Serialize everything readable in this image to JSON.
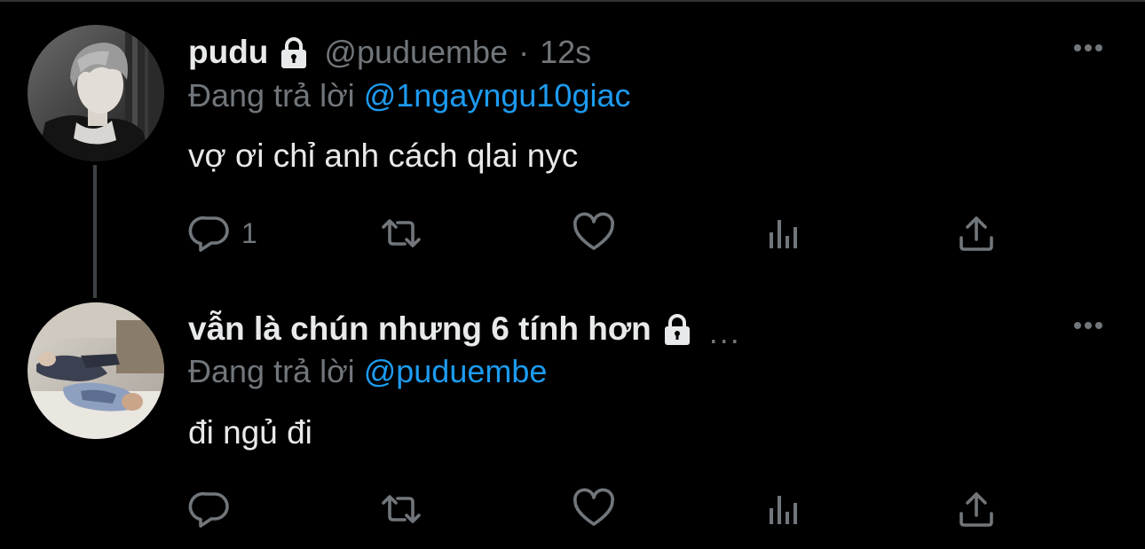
{
  "tweets": [
    {
      "display_name": "pudu",
      "handle": "@puduembe",
      "separator": "·",
      "time": "12s",
      "reply_prefix": "Đang trả lời",
      "reply_to": "@1ngayngu10giac",
      "text": "vợ ơi chỉ anh cách qlai nyc",
      "reply_count": "1",
      "protected": true,
      "avatar": "man-with-grey-hair-black-jacket"
    },
    {
      "display_name": "vẫn là chún nhưng 6 tính hơn",
      "truncation": "...",
      "reply_prefix": "Đang trả lời",
      "reply_to": "@puduembe",
      "text": "đi ngủ đi",
      "reply_count": "",
      "protected": true,
      "avatar": "people-lying-on-bed"
    }
  ],
  "colors": {
    "background": "#000000",
    "text_primary": "#e7e9ea",
    "text_secondary": "#71767b",
    "accent": "#1d9bf0",
    "thread_line": "#3e4144"
  },
  "icons": [
    "lock-icon",
    "more-icon",
    "reply-icon",
    "retweet-icon",
    "like-icon",
    "views-icon",
    "share-icon"
  ]
}
